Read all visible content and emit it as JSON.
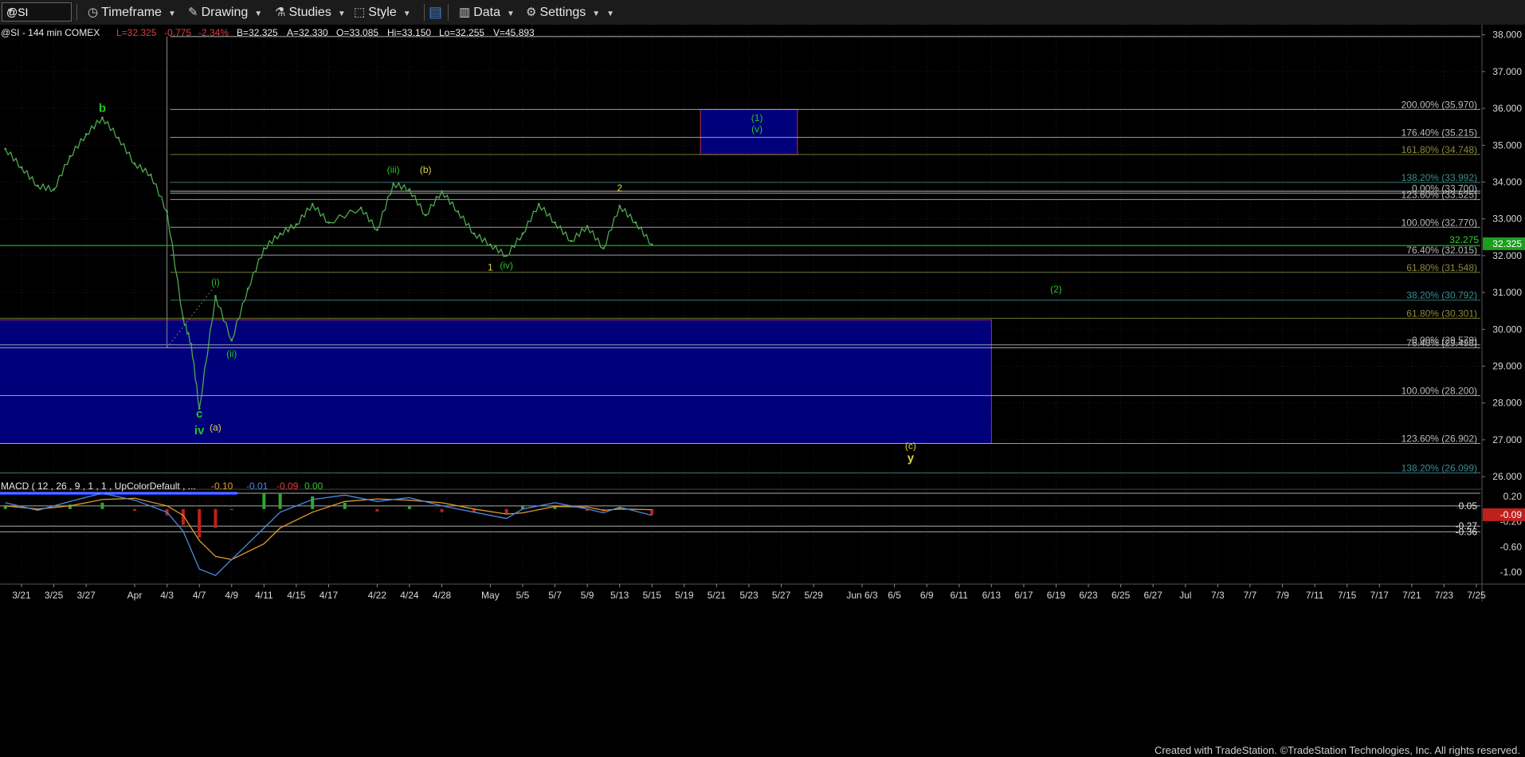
{
  "toolbar": {
    "symbol": "@SI",
    "timeframe_label": "Timeframe",
    "drawing_label": "Drawing",
    "studies_label": "Studies",
    "style_label": "Style",
    "data_label": "Data",
    "settings_label": "Settings",
    "icons": [
      "clock-icon",
      "pencil-icon",
      "flask-icon",
      "style-icon",
      "layout-icon",
      "bars-icon",
      "gear-icon"
    ]
  },
  "header": {
    "symbol_info": "@SI - 144 min  COMEX",
    "last": "L=32.325",
    "change": "-0.775",
    "change_pct": "-2.34%",
    "bid": "B=32.325",
    "ask": "A=32.330",
    "open": "O=33.085",
    "high": "Hi=33.150",
    "low": "Lo=32.255",
    "volume": "V=45,893"
  },
  "footer": "Created with TradeStation. ©TradeStation Technologies, Inc. All rights reserved.",
  "colors": {
    "up": "#1fd11f",
    "price": "#4fa84f",
    "fib_white": "#b8b8b8",
    "fib_teal": "#3c8c8c",
    "fib_olive": "#8a8a3c",
    "box": "#00007a",
    "macd_green": "#2fa82f",
    "macd_red": "#c0201c"
  },
  "chart_data": [
    {
      "type": "line",
      "title": "@SI - 144 min COMEX",
      "x_tick_labels": [
        "3/21",
        "3/25",
        "3/27",
        "Apr",
        "4/3",
        "4/7",
        "4/9",
        "4/11",
        "4/15",
        "4/17",
        "4/22",
        "4/24",
        "4/28",
        "May",
        "5/5",
        "5/7",
        "5/9",
        "5/13",
        "5/15",
        "5/19",
        "5/21",
        "5/23",
        "5/27",
        "5/29",
        "Jun 6/3",
        "6/5",
        "6/9",
        "6/11",
        "6/13",
        "6/17",
        "6/19",
        "6/23",
        "6/25",
        "6/27",
        "Jul",
        "7/3",
        "7/7",
        "7/9",
        "7/11",
        "7/15",
        "7/17",
        "7/21",
        "7/23",
        "7/25"
      ],
      "y_ticks": [
        "38.000",
        "37.000",
        "36.000",
        "35.000",
        "34.000",
        "33.000",
        "32.000",
        "31.000",
        "30.000",
        "29.000",
        "28.000",
        "27.000",
        "26.000"
      ],
      "ylim": [
        25.7,
        38.1
      ],
      "last_price": "32.325",
      "last_line_label": "32.275",
      "price_series": [
        [
          "3/20",
          34.9
        ],
        [
          "3/21",
          34.4
        ],
        [
          "3/24",
          33.9
        ],
        [
          "3/25",
          33.8
        ],
        [
          "3/26",
          34.7
        ],
        [
          "3/27",
          35.3
        ],
        [
          "3/28",
          35.75
        ],
        [
          "3/31",
          35.2
        ],
        [
          "4/1",
          34.5
        ],
        [
          "4/2",
          34.2
        ],
        [
          "4/3",
          33.2
        ],
        [
          "4/4",
          30.3
        ],
        [
          "4/6",
          29.6
        ],
        [
          "4/7",
          27.85
        ],
        [
          "4/8",
          30.9
        ],
        [
          "4/9",
          29.7
        ],
        [
          "4/10",
          31.1
        ],
        [
          "4/11",
          32.2
        ],
        [
          "4/14",
          32.6
        ],
        [
          "4/15",
          32.85
        ],
        [
          "4/16",
          33.4
        ],
        [
          "4/17",
          32.9
        ],
        [
          "4/21",
          33.3
        ],
        [
          "4/22",
          32.7
        ],
        [
          "4/23",
          33.95
        ],
        [
          "4/24",
          33.8
        ],
        [
          "4/25",
          33.1
        ],
        [
          "4/28",
          33.75
        ],
        [
          "4/29",
          33.2
        ],
        [
          "4/30",
          32.6
        ],
        [
          "5/1",
          32.3
        ],
        [
          "5/2",
          32.0
        ],
        [
          "5/5",
          32.6
        ],
        [
          "5/6",
          33.4
        ],
        [
          "5/7",
          32.9
        ],
        [
          "5/8",
          32.4
        ],
        [
          "5/9",
          32.8
        ],
        [
          "5/12",
          32.2
        ],
        [
          "5/13",
          33.35
        ],
        [
          "5/14",
          32.9
        ],
        [
          "5/15",
          32.3
        ]
      ],
      "fib_levels": [
        {
          "label": "200.00% (35.970)",
          "value": 35.97,
          "color": "white"
        },
        {
          "label": "176.40% (35.215)",
          "value": 35.215,
          "color": "white"
        },
        {
          "label": "161.80% (34.748)",
          "value": 34.748,
          "color": "olive"
        },
        {
          "label": "138.20% (33.992)",
          "value": 33.992,
          "color": "teal"
        },
        {
          "label": "0.00% (33.700)",
          "value": 33.7,
          "color": "white"
        },
        {
          "label": "123.60% (33.525)",
          "value": 33.525,
          "color": "white"
        },
        {
          "label": "100.00% (32.770)",
          "value": 32.77,
          "color": "white"
        },
        {
          "label": "76.40% (32.015)",
          "value": 32.015,
          "color": "white"
        },
        {
          "label": "61.80% (31.548)",
          "value": 31.548,
          "color": "olive"
        },
        {
          "label": "38.20% (30.792)",
          "value": 30.792,
          "color": "teal"
        },
        {
          "label": "61.80% (30.301)",
          "value": 30.301,
          "color": "olive"
        },
        {
          "label": "0.00% (29.579)",
          "value": 29.579,
          "color": "white"
        },
        {
          "label": "76.40% (29.498)",
          "value": 29.498,
          "color": "white"
        },
        {
          "label": "100.00% (28.200)",
          "value": 28.2,
          "color": "white"
        },
        {
          "label": "123.60% (26.902)",
          "value": 26.902,
          "color": "white"
        },
        {
          "label": "138.20% (26.099)",
          "value": 26.099,
          "color": "teal"
        }
      ],
      "other_lines": [
        {
          "value": 37.95,
          "color": "white"
        },
        {
          "value": 33.75,
          "color": "white"
        },
        {
          "value": 32.275,
          "color": "green"
        }
      ],
      "target_boxes": [
        {
          "from": "5/20",
          "to": "5/28",
          "high": 35.97,
          "low": 34.748
        },
        {
          "from": "3/19",
          "to": "6/13",
          "high": 30.26,
          "low": 26.902
        }
      ],
      "wave_labels": [
        {
          "text": "b",
          "date": "3/28",
          "price": 35.9,
          "color": "green"
        },
        {
          "text": "(i)",
          "date": "4/8",
          "price": 31.2,
          "color": "green"
        },
        {
          "text": "(ii)",
          "date": "4/9",
          "price": 29.25,
          "color": "green"
        },
        {
          "text": "c",
          "date": "4/7",
          "price": 27.6,
          "color": "green"
        },
        {
          "text": "iv",
          "date": "4/7",
          "price": 27.15,
          "color": "green"
        },
        {
          "text": "(a)",
          "date": "4/8",
          "price": 27.25,
          "color": "yellow"
        },
        {
          "text": "(iii)",
          "date": "4/23",
          "price": 34.25,
          "color": "green"
        },
        {
          "text": "(b)",
          "date": "4/25",
          "price": 34.25,
          "color": "yellow"
        },
        {
          "text": "1",
          "date": "5/1",
          "price": 31.6,
          "color": "yellow"
        },
        {
          "text": "(iv)",
          "date": "5/2",
          "price": 31.65,
          "color": "green"
        },
        {
          "text": "2",
          "date": "5/13",
          "price": 33.75,
          "color": "yellow"
        },
        {
          "text": "(1)",
          "date": "5/24",
          "price": 35.65,
          "color": "green"
        },
        {
          "text": "(v)",
          "date": "5/24",
          "price": 35.35,
          "color": "green"
        },
        {
          "text": "(2)",
          "date": "6/19",
          "price": 31.0,
          "color": "green"
        },
        {
          "text": "(c)",
          "date": "6/6",
          "price": 26.75,
          "color": "yellow"
        },
        {
          "text": "y",
          "date": "6/6",
          "price": 26.4,
          "color": "yellow"
        }
      ]
    },
    {
      "type": "line",
      "title": "MACD ( 12 , 26 , 9 , 1 , 1 , UpColorDefault , ...",
      "header_values": [
        "-0.10",
        "-0.01",
        "-0.09",
        "0.00"
      ],
      "y_ticks": [
        "0.20",
        "-0.20",
        "-0.60",
        "-1.00"
      ],
      "ylim": [
        -1.15,
        0.3
      ],
      "level_labels": [
        {
          "text": "0.05",
          "value": 0.05
        },
        {
          "text": "-0.27",
          "value": -0.27
        },
        {
          "text": "-0.36",
          "value": -0.36
        }
      ],
      "last_value_label": "-0.09",
      "macd_series": [
        [
          "3/20",
          0.1
        ],
        [
          "3/24",
          -0.02
        ],
        [
          "3/26",
          0.12
        ],
        [
          "3/28",
          0.25
        ],
        [
          "4/1",
          0.14
        ],
        [
          "4/3",
          -0.05
        ],
        [
          "4/4",
          -0.35
        ],
        [
          "4/7",
          -0.95
        ],
        [
          "4/8",
          -1.05
        ],
        [
          "4/9",
          -0.8
        ],
        [
          "4/11",
          -0.3
        ],
        [
          "4/14",
          -0.05
        ],
        [
          "4/16",
          0.15
        ],
        [
          "4/18",
          0.22
        ],
        [
          "4/22",
          0.12
        ],
        [
          "4/24",
          0.18
        ],
        [
          "4/28",
          0.05
        ],
        [
          "4/30",
          -0.05
        ],
        [
          "5/2",
          -0.15
        ],
        [
          "5/5",
          0.0
        ],
        [
          "5/7",
          0.1
        ],
        [
          "5/9",
          0.0
        ],
        [
          "5/12",
          -0.06
        ],
        [
          "5/13",
          0.03
        ],
        [
          "5/15",
          -0.1
        ]
      ],
      "signal_series": [
        [
          "3/20",
          0.05
        ],
        [
          "3/24",
          0.0
        ],
        [
          "3/26",
          0.05
        ],
        [
          "3/28",
          0.15
        ],
        [
          "4/1",
          0.17
        ],
        [
          "4/3",
          0.05
        ],
        [
          "4/4",
          -0.1
        ],
        [
          "4/7",
          -0.5
        ],
        [
          "4/8",
          -0.75
        ],
        [
          "4/9",
          -0.8
        ],
        [
          "4/11",
          -0.55
        ],
        [
          "4/14",
          -0.3
        ],
        [
          "4/16",
          -0.05
        ],
        [
          "4/18",
          0.12
        ],
        [
          "4/22",
          0.16
        ],
        [
          "4/24",
          0.14
        ],
        [
          "4/28",
          0.1
        ],
        [
          "4/30",
          0.0
        ],
        [
          "5/2",
          -0.08
        ],
        [
          "5/5",
          -0.06
        ],
        [
          "5/7",
          0.04
        ],
        [
          "5/9",
          0.03
        ],
        [
          "5/12",
          -0.02
        ],
        [
          "5/13",
          0.0
        ],
        [
          "5/15",
          -0.01
        ]
      ]
    }
  ]
}
